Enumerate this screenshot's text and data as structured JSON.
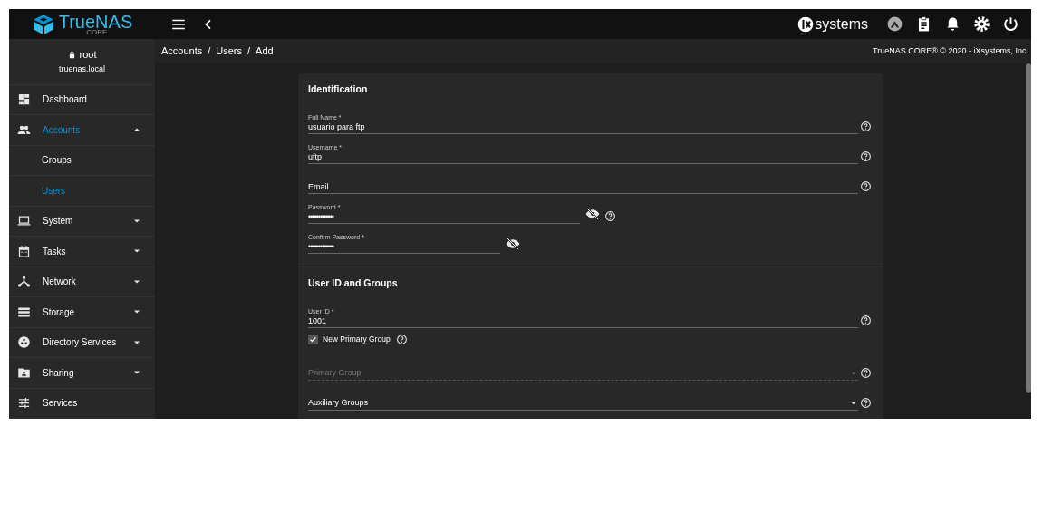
{
  "topbar": {
    "logo": "TrueNAS",
    "logo_sub": "CORE",
    "vendor": "systems"
  },
  "user": {
    "name": "root",
    "host": "truenas.local"
  },
  "sidebar": {
    "items": [
      {
        "label": "Dashboard",
        "kind": "dashboard",
        "selected": false
      },
      {
        "label": "Accounts",
        "kind": "accounts",
        "selected": true,
        "expanded": true,
        "children": [
          {
            "label": "Groups",
            "selected": false
          },
          {
            "label": "Users",
            "selected": true
          }
        ]
      },
      {
        "label": "System",
        "kind": "system",
        "selected": false,
        "expanded": false
      },
      {
        "label": "Tasks",
        "kind": "tasks",
        "selected": false,
        "expanded": false
      },
      {
        "label": "Network",
        "kind": "network",
        "selected": false,
        "expanded": false
      },
      {
        "label": "Storage",
        "kind": "storage",
        "selected": false,
        "expanded": false
      },
      {
        "label": "Directory Services",
        "kind": "directory",
        "selected": false,
        "expanded": false
      },
      {
        "label": "Sharing",
        "kind": "sharing",
        "selected": false,
        "expanded": false
      },
      {
        "label": "Services",
        "kind": "services",
        "selected": false
      }
    ]
  },
  "breadcrumb": [
    "Accounts",
    "/",
    "Users",
    "/",
    "Add"
  ],
  "copyright": "TrueNAS CORE® © 2020 - iXsystems, Inc.",
  "sections": [
    {
      "title": "Identification",
      "fields": [
        {
          "kind": "text",
          "label": "Full Name *",
          "value": "usuario para ftp",
          "help": true
        },
        {
          "kind": "text",
          "label": "Username *",
          "value": "uftp",
          "help": true
        },
        {
          "kind": "text",
          "placeholder": "Email",
          "help": true
        },
        {
          "kind": "password",
          "label": "Password *",
          "value": "•••••••••••••",
          "help": true
        },
        {
          "kind": "password",
          "label": "Confirm Password *",
          "value": "•••••••••••••",
          "help": false
        }
      ]
    },
    {
      "title": "User ID and Groups",
      "fields": [
        {
          "kind": "text",
          "label": "User ID *",
          "value": "1001",
          "help": true
        },
        {
          "kind": "checkbox",
          "label": "New Primary Group",
          "checked": true,
          "help": true
        },
        {
          "kind": "select",
          "placeholder": "Primary Group",
          "disabled": true,
          "help": true
        },
        {
          "kind": "select",
          "placeholder": "Auxiliary Groups",
          "disabled": false,
          "help": true
        }
      ]
    }
  ]
}
